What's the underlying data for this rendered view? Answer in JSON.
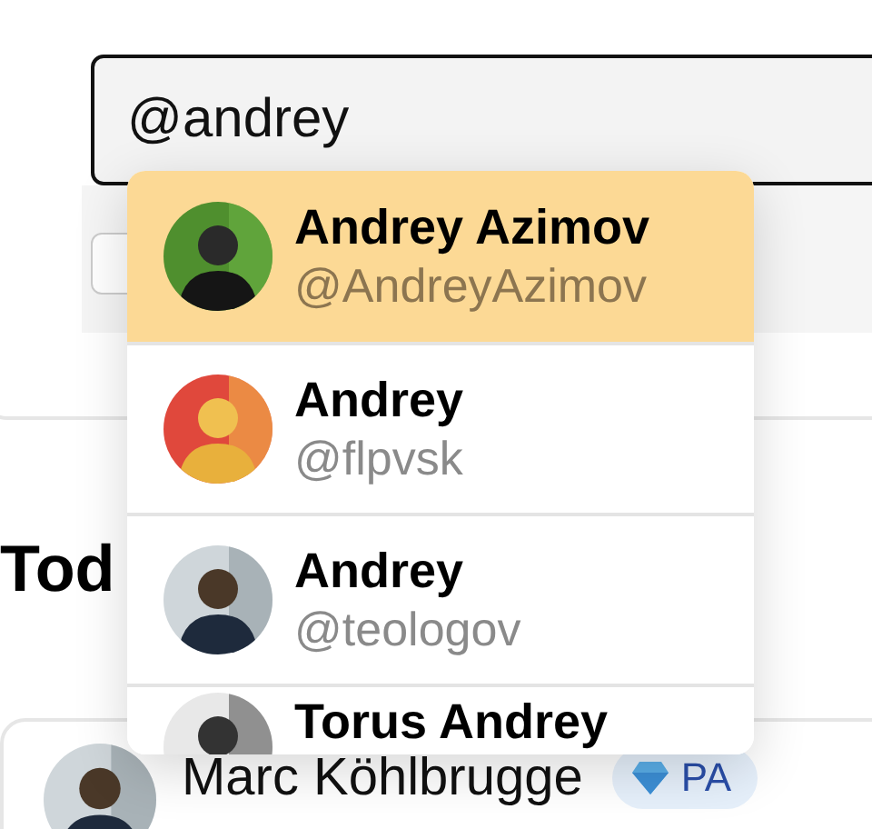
{
  "mention_field": {
    "value": "@andrey"
  },
  "suggestions": [
    {
      "name": "Andrey Azimov",
      "handle": "@AndreyAzimov",
      "selected": true
    },
    {
      "name": "Andrey",
      "handle": "@flpvsk",
      "selected": false
    },
    {
      "name": "Andrey",
      "handle": "@teologov",
      "selected": false
    },
    {
      "name": "Torus Andrey",
      "selected": false
    }
  ],
  "section_heading": "Tod",
  "post": {
    "author": "Marc Köhlbrugge",
    "badge": "PA"
  }
}
